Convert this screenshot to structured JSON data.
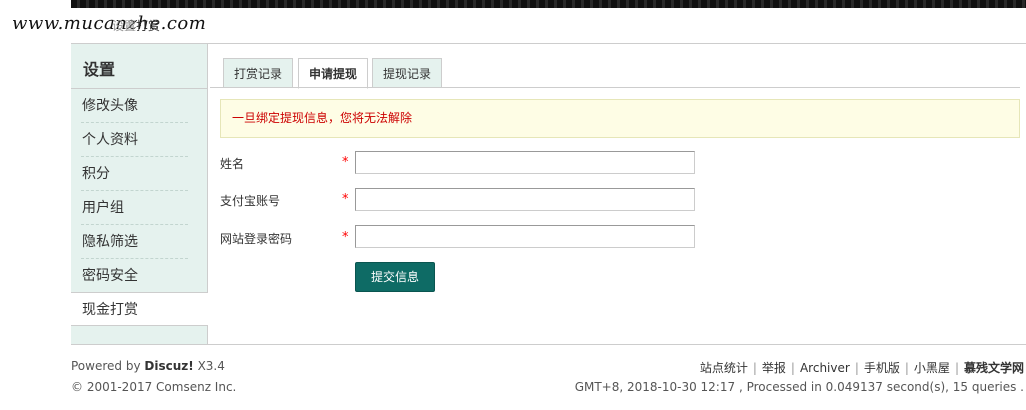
{
  "watermark": "www.mucanzhe.com",
  "breadcrumb": {
    "home": "设置",
    "current": "打赏"
  },
  "sidebar": {
    "title": "设置",
    "items": [
      {
        "label": "修改头像",
        "active": false
      },
      {
        "label": "个人资料",
        "active": false
      },
      {
        "label": "积分",
        "active": false
      },
      {
        "label": "用户组",
        "active": false
      },
      {
        "label": "隐私筛选",
        "active": false
      },
      {
        "label": "密码安全",
        "active": false
      },
      {
        "label": "现金打赏",
        "active": true
      }
    ]
  },
  "tabs": [
    {
      "label": "打赏记录",
      "active": false
    },
    {
      "label": "申请提现",
      "active": true
    },
    {
      "label": "提现记录",
      "active": false
    }
  ],
  "notice": "一旦绑定提现信息，您将无法解除",
  "form": {
    "required_mark": "*",
    "fields": [
      {
        "label": "姓名",
        "value": ""
      },
      {
        "label": "支付宝账号",
        "value": ""
      },
      {
        "label": "网站登录密码",
        "value": ""
      }
    ],
    "submit_label": "提交信息"
  },
  "footer": {
    "powered_prefix": "Powered by",
    "powered_brand": "Discuz!",
    "version": "X3.4",
    "copyright": "© 2001-2017 Comsenz Inc.",
    "links": [
      "站点统计",
      "举报",
      "Archiver",
      "手机版",
      "小黑屋"
    ],
    "site_name": "慕残文学网",
    "stats": "GMT+8, 2018-10-30 12:17 , Processed in 0.049137 second(s), 15 queries ."
  },
  "colors": {
    "sidebar_bg": "#e5f2ee",
    "button_bg": "#0e6b65",
    "notice_bg": "#fefde5",
    "notice_text": "#cc0000"
  }
}
